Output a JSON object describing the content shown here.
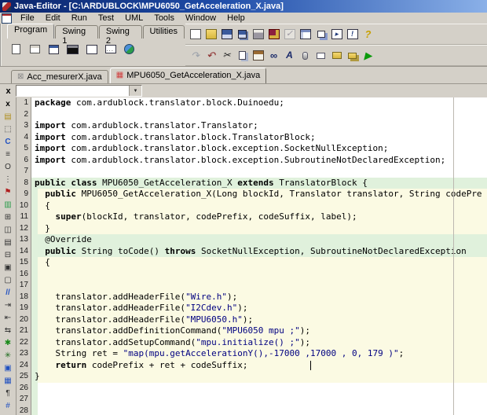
{
  "window": {
    "title": "Java-Editor - [C:\\ARDUBLOCK\\MPU6050_GetAcceleration_X.java]"
  },
  "menu": {
    "items": [
      "File",
      "Edit",
      "Run",
      "Test",
      "UML",
      "Tools",
      "Window",
      "Help"
    ]
  },
  "toolbar": {
    "row1": [
      {
        "name": "new-file-button",
        "icon": "i-new",
        "glyph": ""
      },
      {
        "name": "open-file-button",
        "icon": "i-open",
        "glyph": ""
      },
      {
        "name": "save-button",
        "icon": "i-save",
        "glyph": ""
      },
      {
        "name": "save-all-button",
        "icon": "i-saveall",
        "glyph": ""
      },
      {
        "name": "print-button",
        "icon": "i-print",
        "glyph": ""
      },
      {
        "name": "compile-button",
        "icon": "i-compile",
        "glyph": ""
      },
      {
        "name": "check-button-disabled",
        "icon": "i-check",
        "glyph": "✓"
      },
      {
        "name": "structogram-button",
        "icon": "i-structo",
        "glyph": ""
      },
      {
        "name": "cascade-windows-button",
        "icon": "i-cascade",
        "glyph": ""
      },
      {
        "name": "browser-window-button",
        "icon": "i-browser",
        "glyph": "▸"
      },
      {
        "name": "console-window-button",
        "icon": "i-consoleb",
        "glyph": "!"
      },
      {
        "name": "help-button",
        "icon": "i-help",
        "glyph": "?"
      }
    ],
    "row2": [
      {
        "name": "redo-button",
        "icon": "i-redo",
        "glyph": "↷"
      },
      {
        "name": "undo-button",
        "icon": "i-undo",
        "glyph": "↶"
      },
      {
        "name": "cut-button",
        "icon": "i-cut",
        "glyph": "✂"
      },
      {
        "name": "copy-button",
        "icon": "i-copy",
        "glyph": ""
      },
      {
        "name": "paste-button",
        "icon": "i-paste",
        "glyph": ""
      },
      {
        "name": "find-button",
        "icon": "i-find",
        "glyph": "∞"
      },
      {
        "name": "font-size-button",
        "icon": "i-font",
        "glyph": "A"
      },
      {
        "name": "mouse-button",
        "icon": "i-mouse",
        "glyph": ""
      },
      {
        "name": "widget-button",
        "icon": "i-widget",
        "glyph": ""
      },
      {
        "name": "open-class-button",
        "icon": "i-open2",
        "glyph": ""
      },
      {
        "name": "open-project-button",
        "icon": "i-folders",
        "glyph": ""
      },
      {
        "name": "run-button",
        "icon": "i-run",
        "glyph": "▶"
      }
    ]
  },
  "palette": {
    "tabs": [
      {
        "label": "Program",
        "active": true
      },
      {
        "label": "Swing 1",
        "active": false
      },
      {
        "label": "Swing 2",
        "active": false
      },
      {
        "label": "Utilities",
        "active": false
      }
    ],
    "icons": [
      {
        "name": "new-program-icon",
        "icon": "p-new",
        "glyph": ""
      },
      {
        "name": "structured-page-icon",
        "icon": "p-card",
        "glyph": ""
      },
      {
        "name": "frame-icon",
        "icon": "p-frame",
        "glyph": ""
      },
      {
        "name": "console-icon",
        "icon": "p-console",
        "glyph": ""
      },
      {
        "name": "window-icon",
        "icon": "p-window",
        "glyph": ""
      },
      {
        "name": "dialog-icon",
        "icon": "p-dialog",
        "glyph": "..."
      },
      {
        "name": "applet-icon",
        "icon": "p-applet",
        "glyph": ""
      }
    ]
  },
  "file_tabs": [
    {
      "label": "Acc_mesurerX.java",
      "active": false,
      "icon_glyph": "⊠",
      "icon_color": "#8a8a8a",
      "icon_name": "inactive-file-icon"
    },
    {
      "label": "MPU6050_GetAcceleration_X.java",
      "active": true,
      "icon_glyph": "▦",
      "icon_color": "#d04040",
      "icon_name": "active-file-grid-icon"
    }
  ],
  "search": {
    "close_label": "x",
    "value": ""
  },
  "sidebar": {
    "icons": [
      {
        "name": "close-pane-icon",
        "glyph": "x",
        "color": "#000",
        "bold": true
      },
      {
        "name": "open-folder-icon",
        "glyph": "▤",
        "color": "#b09020"
      },
      {
        "name": "selection-frame-icon",
        "glyph": "⬚",
        "color": "#333"
      },
      {
        "name": "class-icon",
        "glyph": "C",
        "color": "#2050c0",
        "bold": true
      },
      {
        "name": "list-icon",
        "glyph": "≡",
        "color": "#333"
      },
      {
        "name": "object-icon",
        "glyph": "O",
        "color": "#333"
      },
      {
        "name": "dots-icon",
        "glyph": "⋮",
        "color": "#333"
      },
      {
        "name": "flag-icon",
        "glyph": "⚑",
        "color": "#b02020"
      },
      {
        "name": "colors-icon",
        "glyph": "▥",
        "color": "#2a9c4a"
      },
      {
        "name": "frame-split-icon",
        "glyph": "⊞",
        "color": "#333"
      },
      {
        "name": "frame-columns-icon",
        "glyph": "◫",
        "color": "#333"
      },
      {
        "name": "frame-rows-icon",
        "glyph": "▤",
        "color": "#333"
      },
      {
        "name": "frame-grid-icon",
        "glyph": "⊟",
        "color": "#333"
      },
      {
        "name": "frame-inner-icon",
        "glyph": "▣",
        "color": "#333"
      },
      {
        "name": "frame-empty-icon",
        "glyph": "▢",
        "color": "#333"
      },
      {
        "name": "comment-icon",
        "glyph": "//",
        "color": "#2050c0",
        "bold": true
      },
      {
        "name": "indent-icon",
        "glyph": "⇥",
        "color": "#333"
      },
      {
        "name": "outdent-icon",
        "glyph": "⇤",
        "color": "#333"
      },
      {
        "name": "reformat-icon",
        "glyph": "⇆",
        "color": "#333"
      },
      {
        "name": "tree-icon",
        "glyph": "✱",
        "color": "#1a8a1a"
      },
      {
        "name": "tree-dark-icon",
        "glyph": "✳",
        "color": "#1a6a1a"
      },
      {
        "name": "panel-icon",
        "glyph": "▣",
        "color": "#2050c0"
      },
      {
        "name": "panel-alt-icon",
        "glyph": "▦",
        "color": "#2050c0"
      },
      {
        "name": "pilcrow-icon",
        "glyph": "¶",
        "color": "#333"
      },
      {
        "name": "hash-icon",
        "glyph": "#",
        "color": "#2050c0"
      }
    ]
  },
  "editor": {
    "colors": {
      "string": "#000080",
      "band_green": "#e0f1dc",
      "band_yellow": "#fbfae3",
      "margin_line": "#bcb8b0"
    },
    "caret": {
      "line": 24,
      "col": 53
    },
    "lines": [
      {
        "n": 1,
        "bg": "bw",
        "seg": [
          [
            "package",
            "k"
          ],
          [
            " com.ardublock.translator.block.Duinoedu;",
            "n"
          ]
        ]
      },
      {
        "n": 2,
        "bg": "bw",
        "seg": []
      },
      {
        "n": 3,
        "bg": "bw",
        "seg": [
          [
            "import",
            "k"
          ],
          [
            " com.ardublock.translator.Translator;",
            "n"
          ]
        ]
      },
      {
        "n": 4,
        "bg": "bw",
        "seg": [
          [
            "import",
            "k"
          ],
          [
            " com.ardublock.translator.block.TranslatorBlock;",
            "n"
          ]
        ]
      },
      {
        "n": 5,
        "bg": "bw",
        "seg": [
          [
            "import",
            "k"
          ],
          [
            " com.ardublock.translator.block.exception.SocketNullException;",
            "n"
          ]
        ]
      },
      {
        "n": 6,
        "bg": "bw",
        "seg": [
          [
            "import",
            "k"
          ],
          [
            " com.ardublock.translator.block.exception.SubroutineNotDeclaredException;",
            "n"
          ]
        ]
      },
      {
        "n": 7,
        "bg": "bw",
        "seg": []
      },
      {
        "n": 8,
        "bg": "bg",
        "seg": [
          [
            "public class",
            "k"
          ],
          [
            " MPU6050_GetAcceleration_X ",
            "n"
          ],
          [
            "extends",
            "k"
          ],
          [
            " TranslatorBlock {",
            "n"
          ]
        ]
      },
      {
        "n": 9,
        "bg": "by",
        "seg": [
          [
            "  ",
            "n"
          ],
          [
            "public",
            "k"
          ],
          [
            " MPU6050_GetAcceleration_X(Long blockId, Translator translator, String codePre",
            "n"
          ]
        ]
      },
      {
        "n": 10,
        "bg": "by",
        "seg": [
          [
            "  {",
            "n"
          ]
        ]
      },
      {
        "n": 11,
        "bg": "by",
        "seg": [
          [
            "    ",
            "n"
          ],
          [
            "super",
            "k"
          ],
          [
            "(blockId, translator, codePrefix, codeSuffix, label);",
            "n"
          ]
        ]
      },
      {
        "n": 12,
        "bg": "by",
        "seg": [
          [
            "  }",
            "n"
          ]
        ]
      },
      {
        "n": 13,
        "bg": "bg",
        "seg": [
          [
            "  @Override",
            "n"
          ]
        ]
      },
      {
        "n": 14,
        "bg": "bg",
        "seg": [
          [
            "  ",
            "n"
          ],
          [
            "public",
            "k"
          ],
          [
            " String toCode() ",
            "n"
          ],
          [
            "throws",
            "k"
          ],
          [
            " SocketNullException, SubroutineNotDeclaredException",
            "n"
          ]
        ]
      },
      {
        "n": 15,
        "bg": "by",
        "seg": [
          [
            "  {",
            "n"
          ]
        ]
      },
      {
        "n": 16,
        "bg": "by",
        "seg": []
      },
      {
        "n": 17,
        "bg": "by",
        "seg": []
      },
      {
        "n": 18,
        "bg": "by",
        "seg": [
          [
            "    translator.addHeaderFile(",
            "n"
          ],
          [
            "\"Wire.h\"",
            "s"
          ],
          [
            ");",
            "n"
          ]
        ]
      },
      {
        "n": 19,
        "bg": "by",
        "seg": [
          [
            "    translator.addHeaderFile(",
            "n"
          ],
          [
            "\"I2Cdev.h\"",
            "s"
          ],
          [
            ");",
            "n"
          ]
        ]
      },
      {
        "n": 20,
        "bg": "by",
        "seg": [
          [
            "    translator.addHeaderFile(",
            "n"
          ],
          [
            "\"MPU6050.h\"",
            "s"
          ],
          [
            ");",
            "n"
          ]
        ]
      },
      {
        "n": 21,
        "bg": "by",
        "seg": [
          [
            "    translator.addDefinitionCommand(",
            "n"
          ],
          [
            "\"MPU6050 mpu ;\"",
            "s"
          ],
          [
            ");",
            "n"
          ]
        ]
      },
      {
        "n": 22,
        "bg": "by",
        "seg": [
          [
            "    translator.addSetupCommand(",
            "n"
          ],
          [
            "\"mpu.initialize() ;\"",
            "s"
          ],
          [
            ");",
            "n"
          ]
        ]
      },
      {
        "n": 23,
        "bg": "by",
        "seg": [
          [
            "    String ret = ",
            "n"
          ],
          [
            "\"map(mpu.getAccelerationY(),-17000 ,17000 , 0, 179 )\"",
            "s"
          ],
          [
            ";",
            "n"
          ]
        ]
      },
      {
        "n": 24,
        "bg": "by",
        "seg": [
          [
            "    ",
            "n"
          ],
          [
            "return",
            "k"
          ],
          [
            " codePrefix + ret + codeSuffix;",
            "n"
          ]
        ]
      },
      {
        "n": 25,
        "bg": "by",
        "seg": [
          [
            "}",
            "n"
          ]
        ]
      },
      {
        "n": 26,
        "bg": "bs",
        "seg": []
      },
      {
        "n": 27,
        "bg": "bs",
        "seg": []
      },
      {
        "n": 28,
        "bg": "bs",
        "seg": []
      }
    ]
  }
}
